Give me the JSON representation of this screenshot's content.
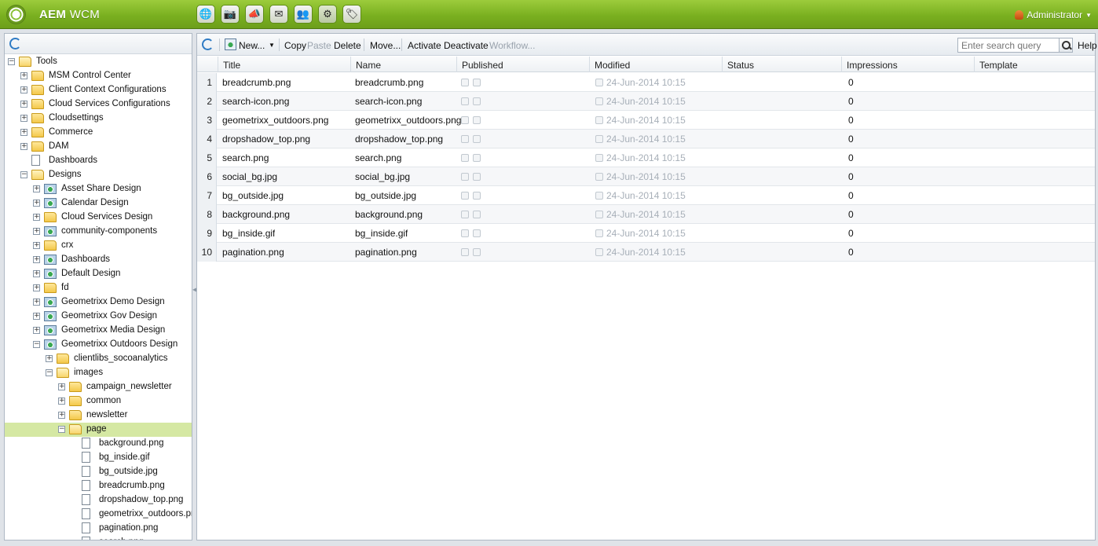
{
  "app": {
    "brand_bold": "AEM",
    "brand_rest": " WCM",
    "user": "Administrator"
  },
  "header_apps": [
    {
      "name": "websites",
      "icon": "globe-icon",
      "glyph": "🌐"
    },
    {
      "name": "dam",
      "icon": "camera-icon",
      "glyph": "📷"
    },
    {
      "name": "campaigns",
      "icon": "megaphone-icon",
      "glyph": "📣"
    },
    {
      "name": "inbox",
      "icon": "mail-icon",
      "glyph": "✉"
    },
    {
      "name": "community",
      "icon": "users-icon",
      "glyph": "👥"
    },
    {
      "name": "tools",
      "icon": "gear-icon",
      "glyph": "⚙"
    },
    {
      "name": "tagging",
      "icon": "tag-icon",
      "glyph": "🏷"
    }
  ],
  "tree": [
    {
      "label": "Tools",
      "level": 0,
      "type": "folder-open",
      "exp": "-"
    },
    {
      "label": "MSM Control Center",
      "level": 1,
      "type": "folder",
      "exp": "+"
    },
    {
      "label": "Client Context Configurations",
      "level": 1,
      "type": "folder",
      "exp": "+"
    },
    {
      "label": "Cloud Services Configurations",
      "level": 1,
      "type": "folder",
      "exp": "+"
    },
    {
      "label": "Cloudsettings",
      "level": 1,
      "type": "folder",
      "exp": "+"
    },
    {
      "label": "Commerce",
      "level": 1,
      "type": "folder",
      "exp": "+"
    },
    {
      "label": "DAM",
      "level": 1,
      "type": "folder",
      "exp": "+"
    },
    {
      "label": "Dashboards",
      "level": 1,
      "type": "page",
      "exp": ""
    },
    {
      "label": "Designs",
      "level": 1,
      "type": "folder-open",
      "exp": "-"
    },
    {
      "label": "Asset Share Design",
      "level": 2,
      "type": "design",
      "exp": "+"
    },
    {
      "label": "Calendar Design",
      "level": 2,
      "type": "design",
      "exp": "+"
    },
    {
      "label": "Cloud Services Design",
      "level": 2,
      "type": "folder",
      "exp": "+"
    },
    {
      "label": "community-components",
      "level": 2,
      "type": "design",
      "exp": "+"
    },
    {
      "label": "crx",
      "level": 2,
      "type": "folder",
      "exp": "+"
    },
    {
      "label": "Dashboards",
      "level": 2,
      "type": "design",
      "exp": "+"
    },
    {
      "label": "Default Design",
      "level": 2,
      "type": "design",
      "exp": "+"
    },
    {
      "label": "fd",
      "level": 2,
      "type": "folder",
      "exp": "+"
    },
    {
      "label": "Geometrixx Demo Design",
      "level": 2,
      "type": "design",
      "exp": "+"
    },
    {
      "label": "Geometrixx Gov Design",
      "level": 2,
      "type": "design",
      "exp": "+"
    },
    {
      "label": "Geometrixx Media Design",
      "level": 2,
      "type": "design",
      "exp": "+"
    },
    {
      "label": "Geometrixx Outdoors Design",
      "level": 2,
      "type": "design",
      "exp": "-"
    },
    {
      "label": "clientlibs_socoanalytics",
      "level": 3,
      "type": "folder",
      "exp": "+"
    },
    {
      "label": "images",
      "level": 3,
      "type": "folder-open",
      "exp": "-"
    },
    {
      "label": "campaign_newsletter",
      "level": 4,
      "type": "folder",
      "exp": "+"
    },
    {
      "label": "common",
      "level": 4,
      "type": "folder",
      "exp": "+"
    },
    {
      "label": "newsletter",
      "level": 4,
      "type": "folder",
      "exp": "+"
    },
    {
      "label": "page",
      "level": 4,
      "type": "folder-open",
      "exp": "-",
      "selected": true
    },
    {
      "label": "background.png",
      "level": 5,
      "type": "page",
      "exp": ""
    },
    {
      "label": "bg_inside.gif",
      "level": 5,
      "type": "page",
      "exp": ""
    },
    {
      "label": "bg_outside.jpg",
      "level": 5,
      "type": "page",
      "exp": ""
    },
    {
      "label": "breadcrumb.png",
      "level": 5,
      "type": "page",
      "exp": ""
    },
    {
      "label": "dropshadow_top.png",
      "level": 5,
      "type": "page",
      "exp": ""
    },
    {
      "label": "geometrixx_outdoors.png",
      "level": 5,
      "type": "page",
      "exp": ""
    },
    {
      "label": "pagination.png",
      "level": 5,
      "type": "page",
      "exp": ""
    },
    {
      "label": "search.png",
      "level": 5,
      "type": "page",
      "exp": ""
    }
  ],
  "toolbar": {
    "new": "New...",
    "copy": "Copy",
    "paste": "Paste",
    "delete": "Delete",
    "move": "Move...",
    "activate": "Activate",
    "deactivate": "Deactivate",
    "workflow": "Workflow...",
    "search_placeholder": "Enter search query",
    "help": "Help"
  },
  "grid": {
    "columns": [
      "Title",
      "Name",
      "Published",
      "Modified",
      "Status",
      "Impressions",
      "Template"
    ],
    "rows": [
      {
        "n": "1",
        "title": "breadcrumb.png",
        "name": "breadcrumb.png",
        "modified": "24-Jun-2014 10:15",
        "impressions": "0"
      },
      {
        "n": "2",
        "title": "search-icon.png",
        "name": "search-icon.png",
        "modified": "24-Jun-2014 10:15",
        "impressions": "0"
      },
      {
        "n": "3",
        "title": "geometrixx_outdoors.png",
        "name": "geometrixx_outdoors.png",
        "modified": "24-Jun-2014 10:15",
        "impressions": "0"
      },
      {
        "n": "4",
        "title": "dropshadow_top.png",
        "name": "dropshadow_top.png",
        "modified": "24-Jun-2014 10:15",
        "impressions": "0"
      },
      {
        "n": "5",
        "title": "search.png",
        "name": "search.png",
        "modified": "24-Jun-2014 10:15",
        "impressions": "0"
      },
      {
        "n": "6",
        "title": "social_bg.jpg",
        "name": "social_bg.jpg",
        "modified": "24-Jun-2014 10:15",
        "impressions": "0"
      },
      {
        "n": "7",
        "title": "bg_outside.jpg",
        "name": "bg_outside.jpg",
        "modified": "24-Jun-2014 10:15",
        "impressions": "0"
      },
      {
        "n": "8",
        "title": "background.png",
        "name": "background.png",
        "modified": "24-Jun-2014 10:15",
        "impressions": "0"
      },
      {
        "n": "9",
        "title": "bg_inside.gif",
        "name": "bg_inside.gif",
        "modified": "24-Jun-2014 10:15",
        "impressions": "0"
      },
      {
        "n": "10",
        "title": "pagination.png",
        "name": "pagination.png",
        "modified": "24-Jun-2014 10:15",
        "impressions": "0"
      }
    ]
  }
}
